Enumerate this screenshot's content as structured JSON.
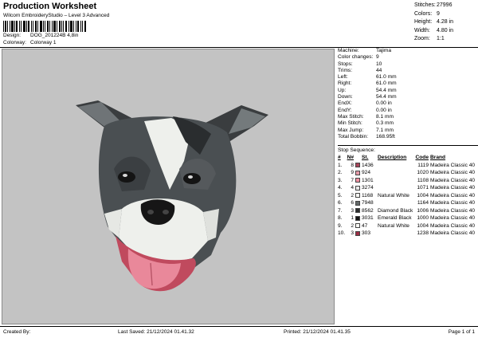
{
  "header": {
    "title": "Production Worksheet",
    "subtitle": "Wilcom EmbroideryStudio – Level 3 Advanced",
    "design_label": "Design:",
    "design_value": "DOG_201224B 4,8in",
    "colorway_label": "Colorway:",
    "colorway_value": "Colorway 1"
  },
  "stats": [
    {
      "label": "Stitches:",
      "value": "27996"
    },
    {
      "label": "Colors:",
      "value": "9"
    },
    {
      "label": "Height:",
      "value": "4.28 in"
    },
    {
      "label": "Width:",
      "value": "4.80 in"
    },
    {
      "label": "Zoom:",
      "value": "1:1"
    }
  ],
  "properties": [
    {
      "label": "Machine:",
      "value": "Tajima"
    },
    {
      "label": "Color changes:",
      "value": "9"
    },
    {
      "label": "Stops:",
      "value": "10"
    },
    {
      "label": "Trims:",
      "value": "44"
    },
    {
      "label": "Left:",
      "value": "61.0 mm"
    },
    {
      "label": "Right:",
      "value": "61.0 mm"
    },
    {
      "label": "Up:",
      "value": "54.4 mm"
    },
    {
      "label": "Down:",
      "value": "54.4 mm"
    },
    {
      "label": "EndX:",
      "value": "0.00 in"
    },
    {
      "label": "EndY:",
      "value": "0.00 in"
    },
    {
      "label": "Max Stitch:",
      "value": "8.1 mm"
    },
    {
      "label": "Min Stitch:",
      "value": "0.3 mm"
    },
    {
      "label": "Max Jump:",
      "value": "7.1 mm"
    },
    {
      "label": "Total Bobbin:",
      "value": "168.95ft"
    }
  ],
  "sequence": {
    "title": "Stop Sequence:",
    "headers": {
      "hash": "#",
      "num": "N#",
      "st": "St.",
      "desc": "Description",
      "code": "Code",
      "brand": "Brand"
    },
    "rows": [
      {
        "hash": "1.",
        "num": "8",
        "color": "#a8455a",
        "st": "1436",
        "desc": "",
        "code": "1119",
        "brand": "Madeira Classic 40"
      },
      {
        "hash": "2.",
        "num": "9",
        "color": "#e59aa8",
        "st": "924",
        "desc": "",
        "code": "1020",
        "brand": "Madeira Classic 40"
      },
      {
        "hash": "3.",
        "num": "7",
        "color": "#ef8f9f",
        "st": "1301",
        "desc": "",
        "code": "1108",
        "brand": "Madeira Classic 40"
      },
      {
        "hash": "4.",
        "num": "4",
        "color": "#e8e8e8",
        "st": "3274",
        "desc": "",
        "code": "1071",
        "brand": "Madeira Classic 40"
      },
      {
        "hash": "5.",
        "num": "2",
        "color": "#fbfbf5",
        "st": "1168",
        "desc": "Natural White",
        "code": "1004",
        "brand": "Madeira Classic 40"
      },
      {
        "hash": "6.",
        "num": "6",
        "color": "#636868",
        "st": "7948",
        "desc": "",
        "code": "1164",
        "brand": "Madeira Classic 40"
      },
      {
        "hash": "7.",
        "num": "3",
        "color": "#2b2d2d",
        "st": "8562",
        "desc": "Diamond Black",
        "code": "1006",
        "brand": "Madeira Classic 40"
      },
      {
        "hash": "8.",
        "num": "1",
        "color": "#151515",
        "st": "3031",
        "desc": "Emerald Black",
        "code": "1000",
        "brand": "Madeira Classic 40"
      },
      {
        "hash": "9.",
        "num": "2",
        "color": "#fbfbf5",
        "st": "47",
        "desc": "Natural White",
        "code": "1004",
        "brand": "Madeira Classic 40"
      },
      {
        "hash": "10.",
        "num": "3",
        "color": "#9c2d44",
        "st": "303",
        "desc": "",
        "code": "1238",
        "brand": "Madeira Classic 40"
      }
    ]
  },
  "footer": {
    "created_by": "Created By:",
    "last_saved": "Last Saved: 21/12/2024 01.41.32",
    "printed": "Printed: 21/12/2024 01.41.35",
    "page": "Page 1 of 1"
  }
}
